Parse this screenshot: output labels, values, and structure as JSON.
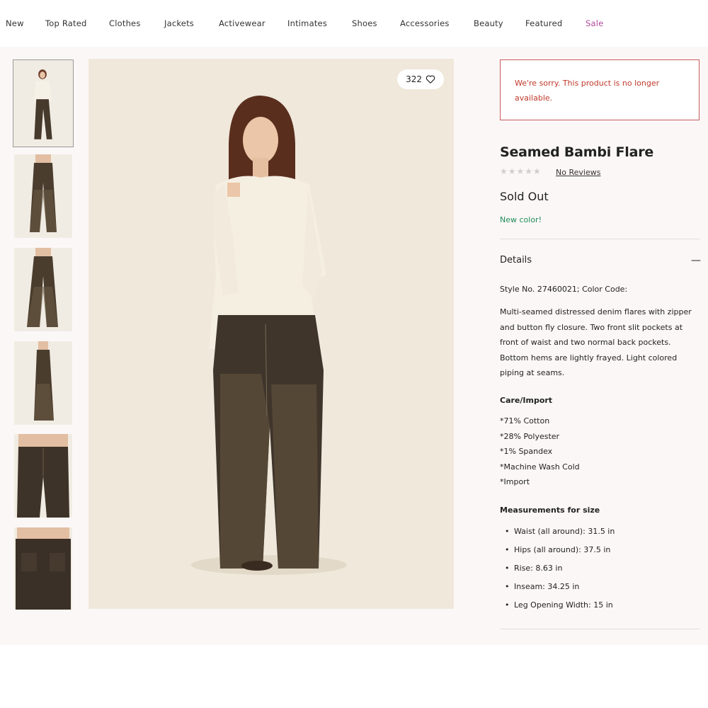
{
  "nav": {
    "items": [
      "New",
      "Top Rated",
      "Clothes",
      "Jackets",
      "Activewear",
      "Intimates",
      "Shoes",
      "Accessories",
      "Beauty",
      "Featured",
      "Sale"
    ]
  },
  "gallery": {
    "thumbnail_count": 6,
    "likes": "322"
  },
  "product": {
    "alert": "We're sorry. This product is no longer available.",
    "name": "Seamed Bambi Flare",
    "rating_stars": "★★★★★",
    "reviews_link": "No Reviews",
    "status": "Sold Out",
    "new_color": "New color!",
    "details_heading": "Details",
    "collapse_symbol": "—",
    "style_line": "Style No. 27460021; Color Code:",
    "description": "Multi-seamed distressed denim flares with zipper and button fly closure. Two front slit pockets at front of waist and two normal back pockets. Bottom hems are lightly frayed. Light colored piping at seams.",
    "care_heading": "Care/Import",
    "care_items": [
      "*71% Cotton",
      "*28% Polyester",
      "*1% Spandex",
      "*Machine Wash Cold",
      "*Import"
    ],
    "measurements_heading": "Measurements for size",
    "measurements": [
      "Waist (all around): 31.5 in",
      "Hips (all around): 37.5 in",
      "Rise: 8.63 in",
      "Inseam: 34.25 in",
      "Leg Opening Width: 15 in"
    ]
  },
  "colors": {
    "alert_text": "#c0392b",
    "alert_border": "#c75b5b",
    "new_color": "#1e8d5a",
    "sale_link": "#b04a9c",
    "page_bg": "#fcf7f7"
  }
}
